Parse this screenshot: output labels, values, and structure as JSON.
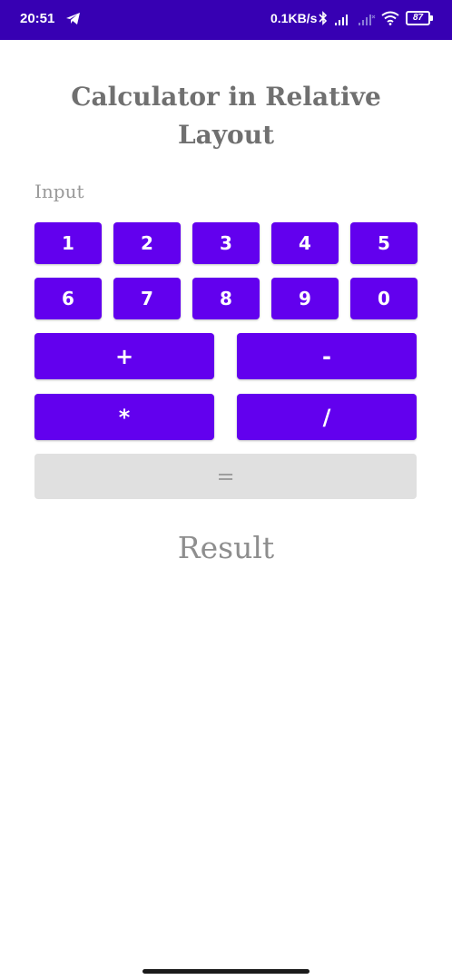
{
  "status_bar": {
    "time": "20:51",
    "network_speed": "0.1KB/s",
    "battery_level": "87",
    "background_color": "#3700B3",
    "icons": [
      "telegram-icon",
      "bluetooth-icon",
      "signal-icon",
      "signal-icon",
      "wifi-icon",
      "battery-icon"
    ]
  },
  "app": {
    "title": "Calculator in Relative Layout",
    "input_placeholder": "Input",
    "result_text": "Result",
    "accent_color": "#6200EE"
  },
  "keypad": {
    "row1": [
      "1",
      "2",
      "3",
      "4",
      "5"
    ],
    "row2": [
      "6",
      "7",
      "8",
      "9",
      "0"
    ],
    "ops": [
      "+",
      "-",
      "*",
      "/"
    ],
    "equals": "="
  }
}
